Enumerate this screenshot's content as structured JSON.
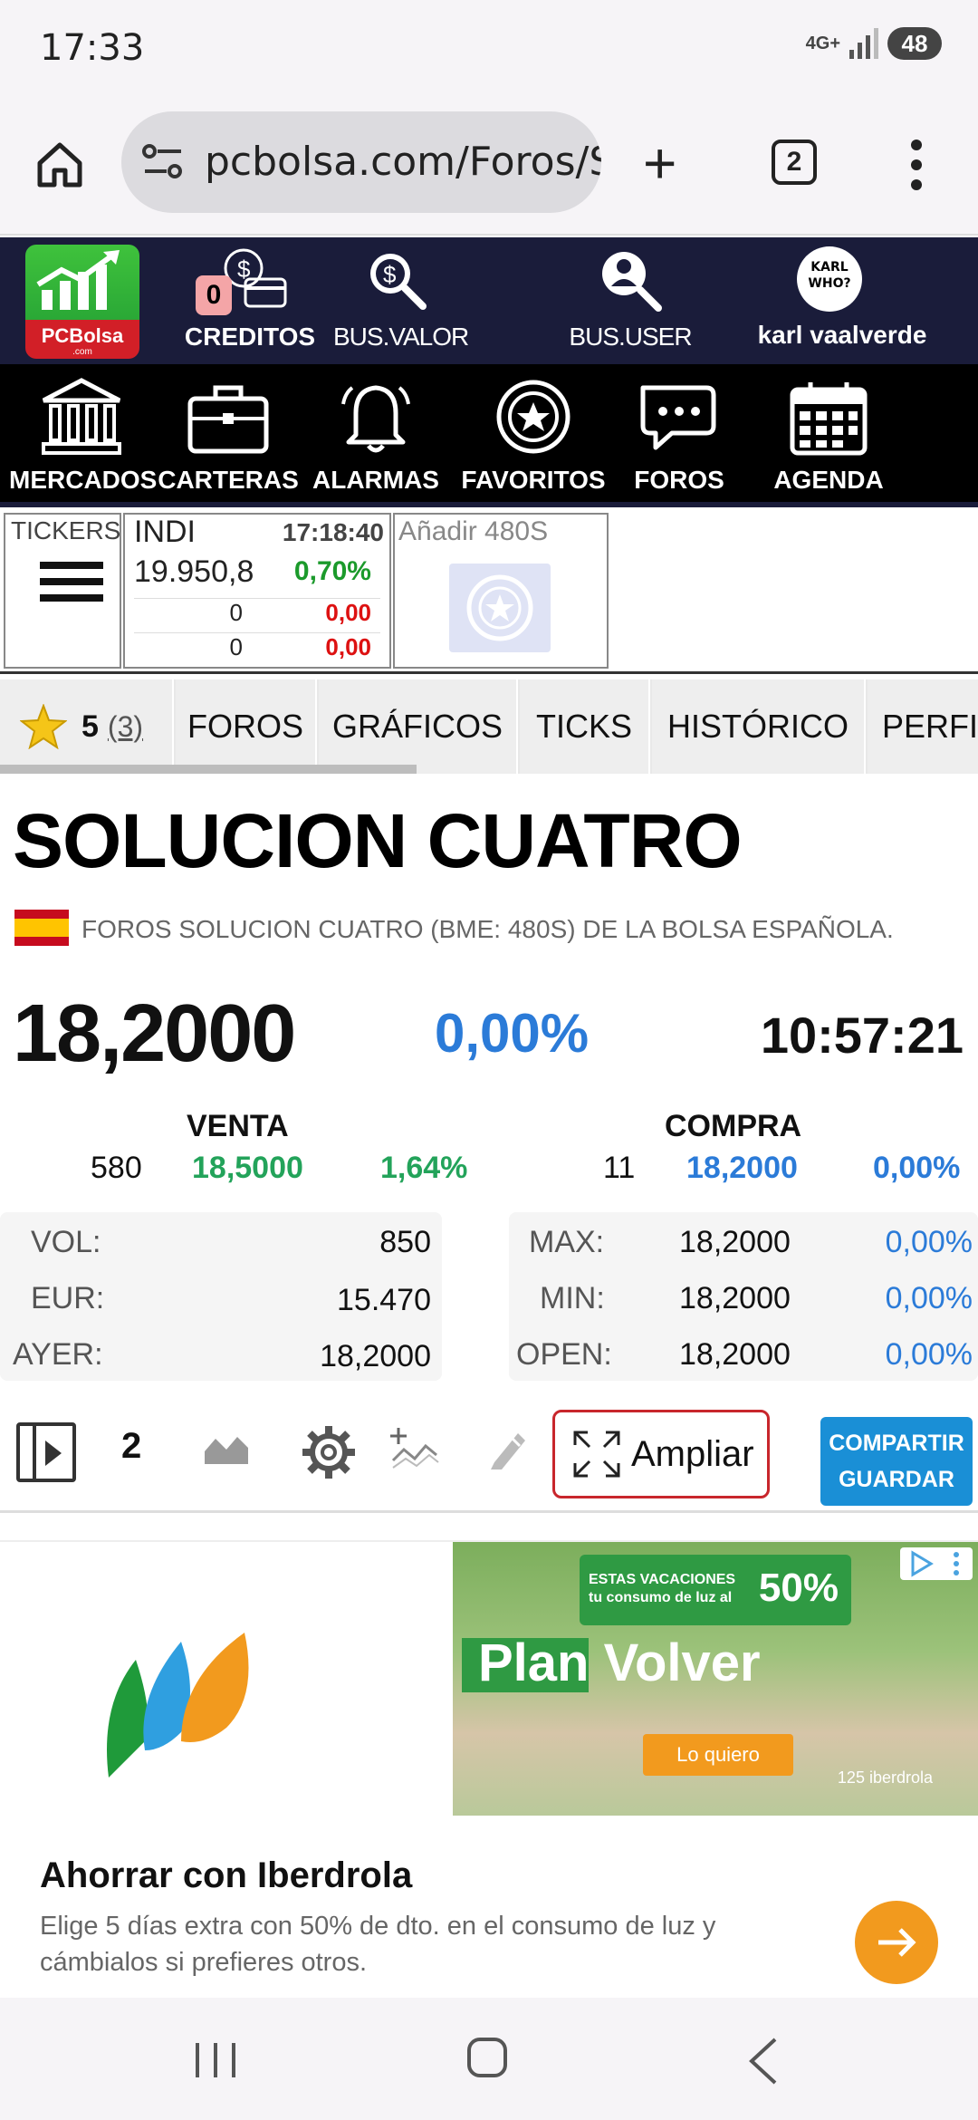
{
  "status_bar": {
    "time": "17:33",
    "network": "4G+",
    "battery": "48"
  },
  "browser": {
    "url": "pcbolsa.com/Foros/S",
    "tab_count": "2"
  },
  "header": {
    "logo_text": "PCBolsa",
    "logo_sub": ".com",
    "creditos_label": "CREDITOS",
    "creditos_count": "0",
    "busvalor_label": "BUS.VALOR",
    "bususer_label": "BUS.USER",
    "user_name": "karl vaalverde",
    "avatar_text": "KARL WHO?"
  },
  "nav": {
    "items": [
      {
        "label": "MERCADOS"
      },
      {
        "label": "CARTERAS"
      },
      {
        "label": "ALARMAS"
      },
      {
        "label": "FAVORITOS"
      },
      {
        "label": "FOROS"
      },
      {
        "label": "AGENDA"
      }
    ]
  },
  "ticker": {
    "tickers_label": "TICKERS",
    "index_name": "INDI",
    "index_time": "17:18:40",
    "index_price": "19.950,8",
    "index_pct": "0,70%",
    "row1_qty": "0",
    "row1_val": "0,00",
    "row2_qty": "0",
    "row2_val": "0,00",
    "add_label": "Añadir 480S"
  },
  "tabs": {
    "rating_value": "5",
    "rating_count": "(3)",
    "items": [
      "FOROS",
      "GRÁFICOS",
      "TICKS",
      "HISTÓRICO",
      "PERFI"
    ]
  },
  "stock": {
    "title": "SOLUCION CUATRO",
    "subtitle": "FOROS SOLUCION CUATRO (BME: 480S) DE LA BOLSA ESPAÑOLA.",
    "price": "18,2000",
    "change_pct": "0,00%",
    "time": "10:57:21",
    "venta_label": "VENTA",
    "venta_qty": "580",
    "venta_price": "18,5000",
    "venta_pct": "1,64%",
    "compra_label": "COMPRA",
    "compra_qty": "11",
    "compra_price": "18,2000",
    "compra_pct": "0,00%",
    "vol_label": "VOL:",
    "vol": "850",
    "eur_label": "EUR:",
    "eur": "15.470",
    "ayer_label": "AYER:",
    "ayer": "18,2000",
    "max_label": "MAX:",
    "max": "18,2000",
    "max_pct": "0,00%",
    "min_label": "MIN:",
    "min": "18,2000",
    "min_pct": "0,00%",
    "open_label": "OPEN:",
    "open": "18,2000",
    "open_pct": "0,00%"
  },
  "toolbar": {
    "chart_count": "2",
    "ampliar_label": "Ampliar",
    "share_line1": "COMPARTIR",
    "share_line2": "GUARDAR"
  },
  "ad": {
    "banner_small": "ESTAS VACACIONES tu consumo de luz al",
    "banner_big": "50%",
    "plan_text": "Plan Volver",
    "cta": "Lo quiero",
    "footer": "125 iberdrola",
    "title": "Ahorrar con Iberdrola",
    "description": "Elige 5 días extra con 50% de dto. en el consumo de luz y cámbialos si prefieres otros.",
    "brand_colors": {
      "green": "#1f9a3a",
      "blue": "#2f9fe0",
      "orange": "#f29a1e"
    }
  },
  "colors": {
    "header_bg": "#1a1c3a",
    "nav_bg": "#000000",
    "green": "#23a35a",
    "blue": "#2b7bd8",
    "red": "#d11111"
  }
}
